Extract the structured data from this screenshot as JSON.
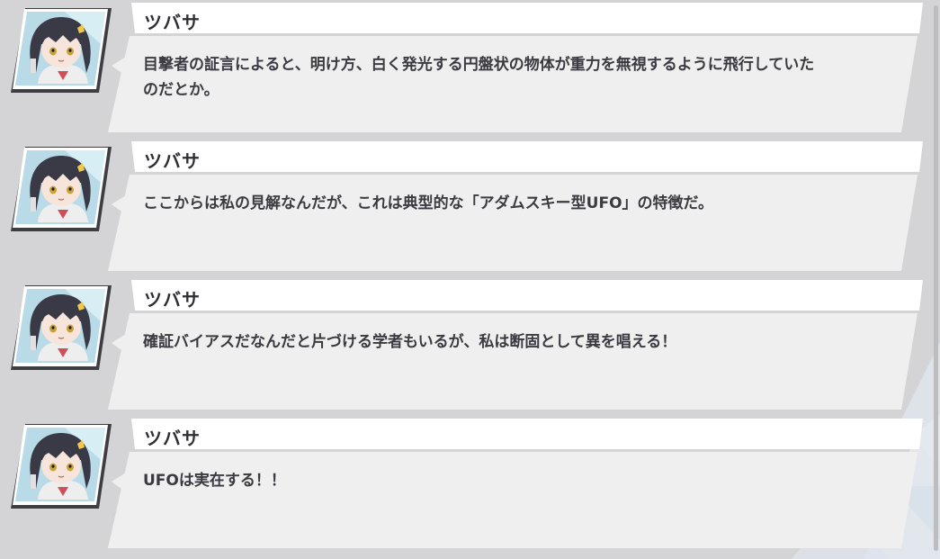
{
  "accent_color": "#f2f2f3",
  "icon_names": [
    "tsubasa-portrait-icon"
  ],
  "log": {
    "entries": [
      {
        "speaker": "ツバサ",
        "text": "目撃者の証言によると、明け方、白く発光する円盤状の物体が重力を無視するように飛行していたのだとか。"
      },
      {
        "speaker": "ツバサ",
        "text": "ここからは私の見解なんだが、これは典型的な「アダムスキー型UFO」の特徴だ。"
      },
      {
        "speaker": "ツバサ",
        "text": "確証バイアスだなんだと片づける学者もいるが、私は断固として異を唱える！"
      },
      {
        "speaker": "ツバサ",
        "text": "UFOは実在する！！"
      }
    ]
  }
}
